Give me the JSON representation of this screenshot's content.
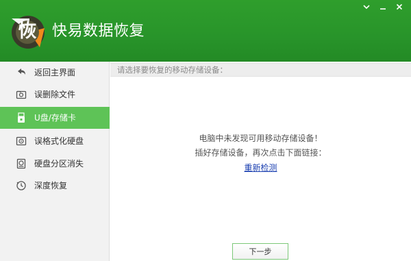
{
  "app": {
    "title": "快易数据恢复",
    "logo_char": "恢",
    "brand_color": "#2a962b",
    "accent_color": "#5ec357"
  },
  "window_controls": [
    {
      "name": "minimize-icon"
    },
    {
      "name": "restore-icon"
    },
    {
      "name": "close-icon"
    }
  ],
  "sidebar": {
    "items": [
      {
        "label": "返回主界面",
        "icon": "back-arrow-icon",
        "active": false
      },
      {
        "label": "误删除文件",
        "icon": "folder-icon",
        "active": false
      },
      {
        "label": "U盘/存储卡",
        "icon": "usb-drive-icon",
        "active": true
      },
      {
        "label": "误格式化硬盘",
        "icon": "hard-disk-icon",
        "active": false
      },
      {
        "label": "硬盘分区消失",
        "icon": "disk-partition-icon",
        "active": false
      },
      {
        "label": "深度恢复",
        "icon": "deep-scan-icon",
        "active": false
      }
    ]
  },
  "main": {
    "prompt": "请选择要恢复的移动存储设备：",
    "message_line1": "电脑中未发现可用移动存储设备！",
    "message_line2": "插好存储设备，再次点击下面链接：",
    "rescan_link": "重新检测",
    "next_button": "下一步"
  }
}
